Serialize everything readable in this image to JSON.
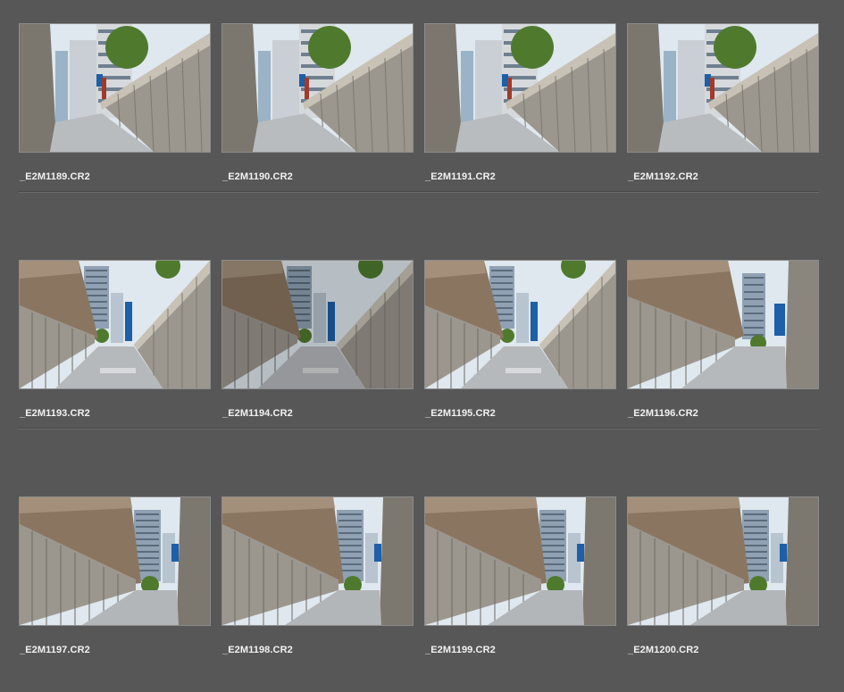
{
  "rows": [
    {
      "items": [
        {
          "filename": "_E2M1189.CR2",
          "view": "up"
        },
        {
          "filename": "_E2M1190.CR2",
          "view": "up"
        },
        {
          "filename": "_E2M1191.CR2",
          "view": "up"
        },
        {
          "filename": "_E2M1192.CR2",
          "view": "up"
        }
      ]
    },
    {
      "items": [
        {
          "filename": "_E2M1193.CR2",
          "view": "mid"
        },
        {
          "filename": "_E2M1194.CR2",
          "view": "mid-dark"
        },
        {
          "filename": "_E2M1195.CR2",
          "view": "mid"
        },
        {
          "filename": "_E2M1196.CR2",
          "view": "side"
        }
      ]
    },
    {
      "items": [
        {
          "filename": "_E2M1197.CR2",
          "view": "low"
        },
        {
          "filename": "_E2M1198.CR2",
          "view": "low"
        },
        {
          "filename": "_E2M1199.CR2",
          "view": "low"
        },
        {
          "filename": "_E2M1200.CR2",
          "view": "low"
        }
      ]
    }
  ],
  "colors": {
    "background": "#575757",
    "thumb_border": "#8c8c8c",
    "filename_text": "#f2f2f2",
    "sky": "#dfe8ee",
    "wall": "#9c978e",
    "facade": "#8a7660",
    "tree": "#4f7a2e",
    "sign_blue": "#1d5fa8"
  }
}
